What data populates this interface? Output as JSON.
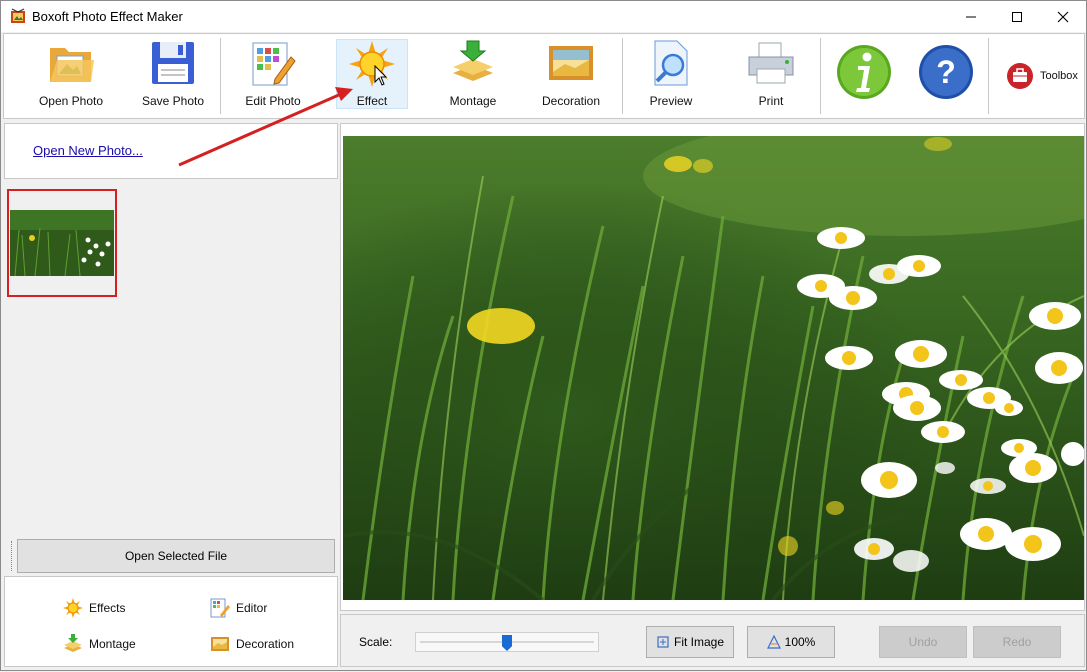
{
  "window": {
    "title": "Boxoft Photo Effect Maker"
  },
  "toolbar": {
    "open_photo": "Open Photo",
    "save_photo": "Save Photo",
    "edit_photo": "Edit Photo",
    "effect": "Effect",
    "montage": "Montage",
    "decoration": "Decoration",
    "preview": "Preview",
    "print": "Print",
    "toolbox": "Toolbox"
  },
  "left_panel": {
    "open_new_photo": "Open New Photo...",
    "open_selected_file": "Open Selected File",
    "shortcuts": {
      "effects": "Effects",
      "editor": "Editor",
      "montage": "Montage",
      "decoration": "Decoration"
    }
  },
  "bottom_bar": {
    "scale_label": "Scale:",
    "scale_level": 0.5,
    "fit_image": "Fit Image",
    "zoom_100": "100%",
    "undo": "Undo",
    "redo": "Redo"
  },
  "colors": {
    "accent_blue": "#1a6ad4",
    "selection_red": "#d42020",
    "link": "#1a0dab",
    "active_button_bg": "#e5f1fb"
  }
}
